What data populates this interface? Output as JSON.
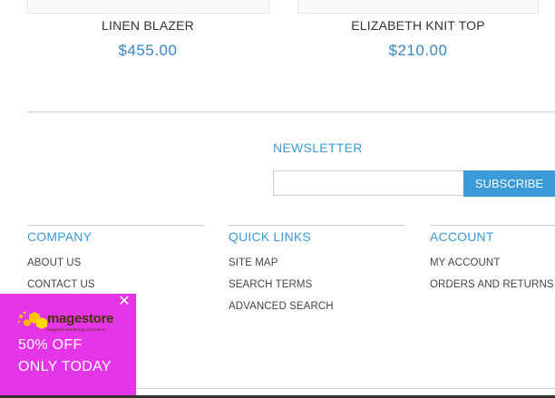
{
  "products": [
    {
      "name": "LINEN BLAZER",
      "price": "$455.00"
    },
    {
      "name": "ELIZABETH KNIT TOP",
      "price": "$210.00"
    }
  ],
  "newsletter": {
    "title": "NEWSLETTER",
    "input_value": "",
    "button_label": "SUBSCRIBE"
  },
  "footer": {
    "company": {
      "title": "COMPANY",
      "links": [
        "ABOUT US",
        "CONTACT US"
      ]
    },
    "quick_links": {
      "title": "QUICK LINKS",
      "links": [
        "SITE MAP",
        "SEARCH TERMS",
        "ADVANCED SEARCH"
      ]
    },
    "account": {
      "title": "ACCOUNT",
      "links": [
        "MY ACCOUNT",
        "ORDERS AND RETURNS"
      ]
    }
  },
  "promo": {
    "logo_text": "magestore",
    "logo_tagline": "Magento Marketing Solutions",
    "line1": "50% OFF",
    "line2": "ONLY TODAY",
    "close_icon": "close-icon",
    "background_color": "#e535e8"
  },
  "colors": {
    "accent": "#3a9bd8",
    "price": "#3b86c2"
  }
}
